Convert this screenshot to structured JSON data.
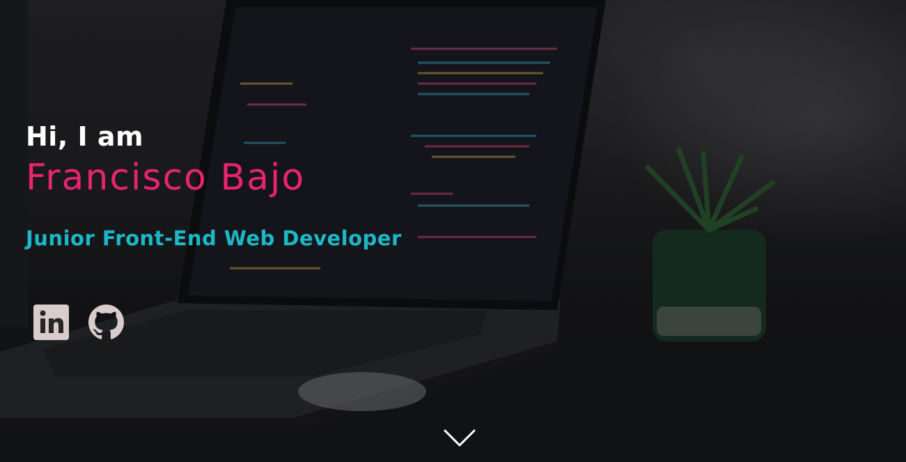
{
  "hero": {
    "greeting": "Hi, I am",
    "name": "Francisco Bajo",
    "role": "Junior Front-End Web Developer"
  },
  "socials": [
    {
      "icon": "linkedin-icon",
      "label": "in"
    },
    {
      "icon": "github-icon"
    }
  ],
  "scroll": {
    "icon": "chevron-down-icon"
  },
  "colors": {
    "greeting": "#ffffff",
    "name": "#e8246f",
    "role": "#1cb8c8",
    "icons": "#d9cccc"
  }
}
